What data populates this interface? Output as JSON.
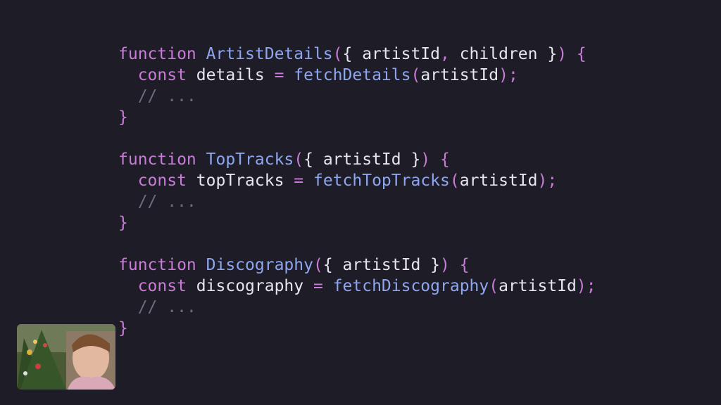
{
  "code": {
    "lines": [
      [
        {
          "t": "function",
          "c": "kw"
        },
        {
          "t": " ",
          "c": "pn"
        },
        {
          "t": "ArtistDetails",
          "c": "fn"
        },
        {
          "t": "(",
          "c": "br"
        },
        {
          "t": "{ artistId",
          "c": "pn"
        },
        {
          "t": ",",
          "c": "op"
        },
        {
          "t": " children }",
          "c": "pn"
        },
        {
          "t": ")",
          "c": "br"
        },
        {
          "t": " ",
          "c": "pn"
        },
        {
          "t": "{",
          "c": "br"
        }
      ],
      [
        {
          "t": "  ",
          "c": "pn"
        },
        {
          "t": "const",
          "c": "kw"
        },
        {
          "t": " details ",
          "c": "pn"
        },
        {
          "t": "=",
          "c": "op"
        },
        {
          "t": " ",
          "c": "pn"
        },
        {
          "t": "fetchDetails",
          "c": "fn"
        },
        {
          "t": "(",
          "c": "br"
        },
        {
          "t": "artistId",
          "c": "pn"
        },
        {
          "t": ")",
          "c": "br"
        },
        {
          "t": ";",
          "c": "op"
        }
      ],
      [
        {
          "t": "  ",
          "c": "pn"
        },
        {
          "t": "// ...",
          "c": "cm"
        }
      ],
      [
        {
          "t": "}",
          "c": "br"
        }
      ],
      [],
      [
        {
          "t": "function",
          "c": "kw"
        },
        {
          "t": " ",
          "c": "pn"
        },
        {
          "t": "TopTracks",
          "c": "fn"
        },
        {
          "t": "(",
          "c": "br"
        },
        {
          "t": "{ artistId }",
          "c": "pn"
        },
        {
          "t": ")",
          "c": "br"
        },
        {
          "t": " ",
          "c": "pn"
        },
        {
          "t": "{",
          "c": "br"
        }
      ],
      [
        {
          "t": "  ",
          "c": "pn"
        },
        {
          "t": "const",
          "c": "kw"
        },
        {
          "t": " topTracks ",
          "c": "pn"
        },
        {
          "t": "=",
          "c": "op"
        },
        {
          "t": " ",
          "c": "pn"
        },
        {
          "t": "fetchTopTracks",
          "c": "fn"
        },
        {
          "t": "(",
          "c": "br"
        },
        {
          "t": "artistId",
          "c": "pn"
        },
        {
          "t": ")",
          "c": "br"
        },
        {
          "t": ";",
          "c": "op"
        }
      ],
      [
        {
          "t": "  ",
          "c": "pn"
        },
        {
          "t": "// ...",
          "c": "cm"
        }
      ],
      [
        {
          "t": "}",
          "c": "br"
        }
      ],
      [],
      [
        {
          "t": "function",
          "c": "kw"
        },
        {
          "t": " ",
          "c": "pn"
        },
        {
          "t": "Discography",
          "c": "fn"
        },
        {
          "t": "(",
          "c": "br"
        },
        {
          "t": "{ artistId }",
          "c": "pn"
        },
        {
          "t": ")",
          "c": "br"
        },
        {
          "t": " ",
          "c": "pn"
        },
        {
          "t": "{",
          "c": "br"
        }
      ],
      [
        {
          "t": "  ",
          "c": "pn"
        },
        {
          "t": "const",
          "c": "kw"
        },
        {
          "t": " discography ",
          "c": "pn"
        },
        {
          "t": "=",
          "c": "op"
        },
        {
          "t": " ",
          "c": "pn"
        },
        {
          "t": "fetchDiscography",
          "c": "fn"
        },
        {
          "t": "(",
          "c": "br"
        },
        {
          "t": "artistId",
          "c": "pn"
        },
        {
          "t": ")",
          "c": "br"
        },
        {
          "t": ";",
          "c": "op"
        }
      ],
      [
        {
          "t": "  ",
          "c": "pn"
        },
        {
          "t": "// ...",
          "c": "cm"
        }
      ],
      [
        {
          "t": "}",
          "c": "br"
        }
      ]
    ]
  },
  "theme": {
    "background": "#1e1d27",
    "keyword": "#c97bd8",
    "function_name": "#8ea6ef",
    "plain": "#e6e6ee",
    "comment": "#6e6d7a"
  },
  "webcam": {
    "icon": "presenter-webcam"
  }
}
